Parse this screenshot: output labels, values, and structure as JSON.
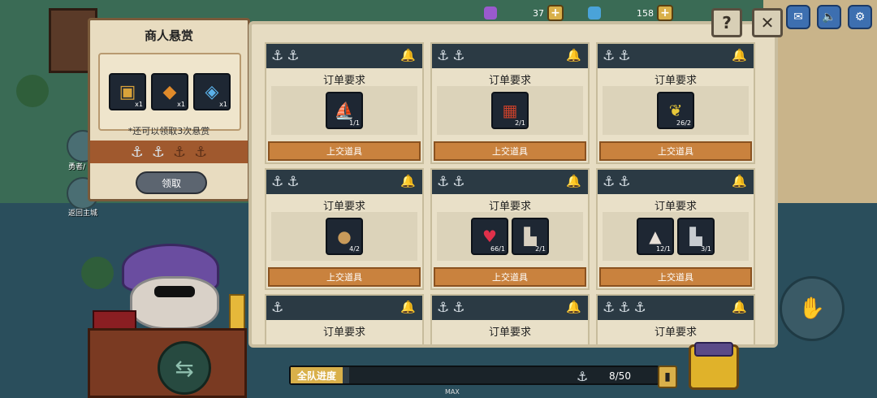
{
  "resources": [
    {
      "name": "purple-gem",
      "value": "37",
      "color": "#9a5acd"
    },
    {
      "name": "blue-gem",
      "value": "158",
      "color": "#4aa3d9"
    }
  ],
  "merchant": {
    "title": "商人悬赏",
    "rewards": [
      {
        "icon": "treasure-chest-icon",
        "qty": "x1"
      },
      {
        "icon": "orange-scroll-icon",
        "qty": "x1"
      },
      {
        "icon": "blue-crystal-icon",
        "qty": "x1"
      }
    ],
    "note": "*还可以领取3次悬赏",
    "anchors_filled": 2,
    "anchors_total": 4,
    "claim_label": "领取"
  },
  "side_labels": {
    "hero": "勇者/",
    "return": "返回主城"
  },
  "orders": [
    {
      "title": "订单要求",
      "anchors": 2,
      "items": [
        {
          "icon": "golden-boat-icon",
          "qty": "1/1"
        }
      ],
      "submit": "上交道具"
    },
    {
      "title": "订单要求",
      "anchors": 2,
      "items": [
        {
          "icon": "red-treasure-icon",
          "qty": "2/1"
        }
      ],
      "submit": "上交道具"
    },
    {
      "title": "订单要求",
      "anchors": 2,
      "items": [
        {
          "icon": "corn-icon",
          "qty": "26/2"
        }
      ],
      "submit": "上交道具"
    },
    {
      "title": "订单要求",
      "anchors": 2,
      "items": [
        {
          "icon": "potato-icon",
          "qty": "4/2"
        }
      ],
      "submit": "上交道具"
    },
    {
      "title": "订单要求",
      "anchors": 2,
      "items": [
        {
          "icon": "red-potion-icon",
          "qty": "66/1"
        },
        {
          "icon": "boot-icon",
          "qty": "2/1"
        }
      ],
      "submit": "上交道具"
    },
    {
      "title": "订单要求",
      "anchors": 2,
      "items": [
        {
          "icon": "salt-pile-icon",
          "qty": "12/1"
        },
        {
          "icon": "white-boot-icon",
          "qty": "3/1"
        }
      ],
      "submit": "上交道具"
    },
    {
      "title": "订单要求",
      "anchors": 1,
      "items": [],
      "submit": ""
    },
    {
      "title": "订单要求",
      "anchors": 2,
      "items": [],
      "submit": ""
    },
    {
      "title": "订单要求",
      "anchors": 3,
      "items": [],
      "submit": ""
    }
  ],
  "progress": {
    "label": "全队进度",
    "count": "8/50",
    "fraction": 0.16,
    "max_label": "MAX"
  },
  "colors": {
    "header": "#2b3a44",
    "submit": "#c9823e",
    "accent_gold": "#d9b04a"
  }
}
